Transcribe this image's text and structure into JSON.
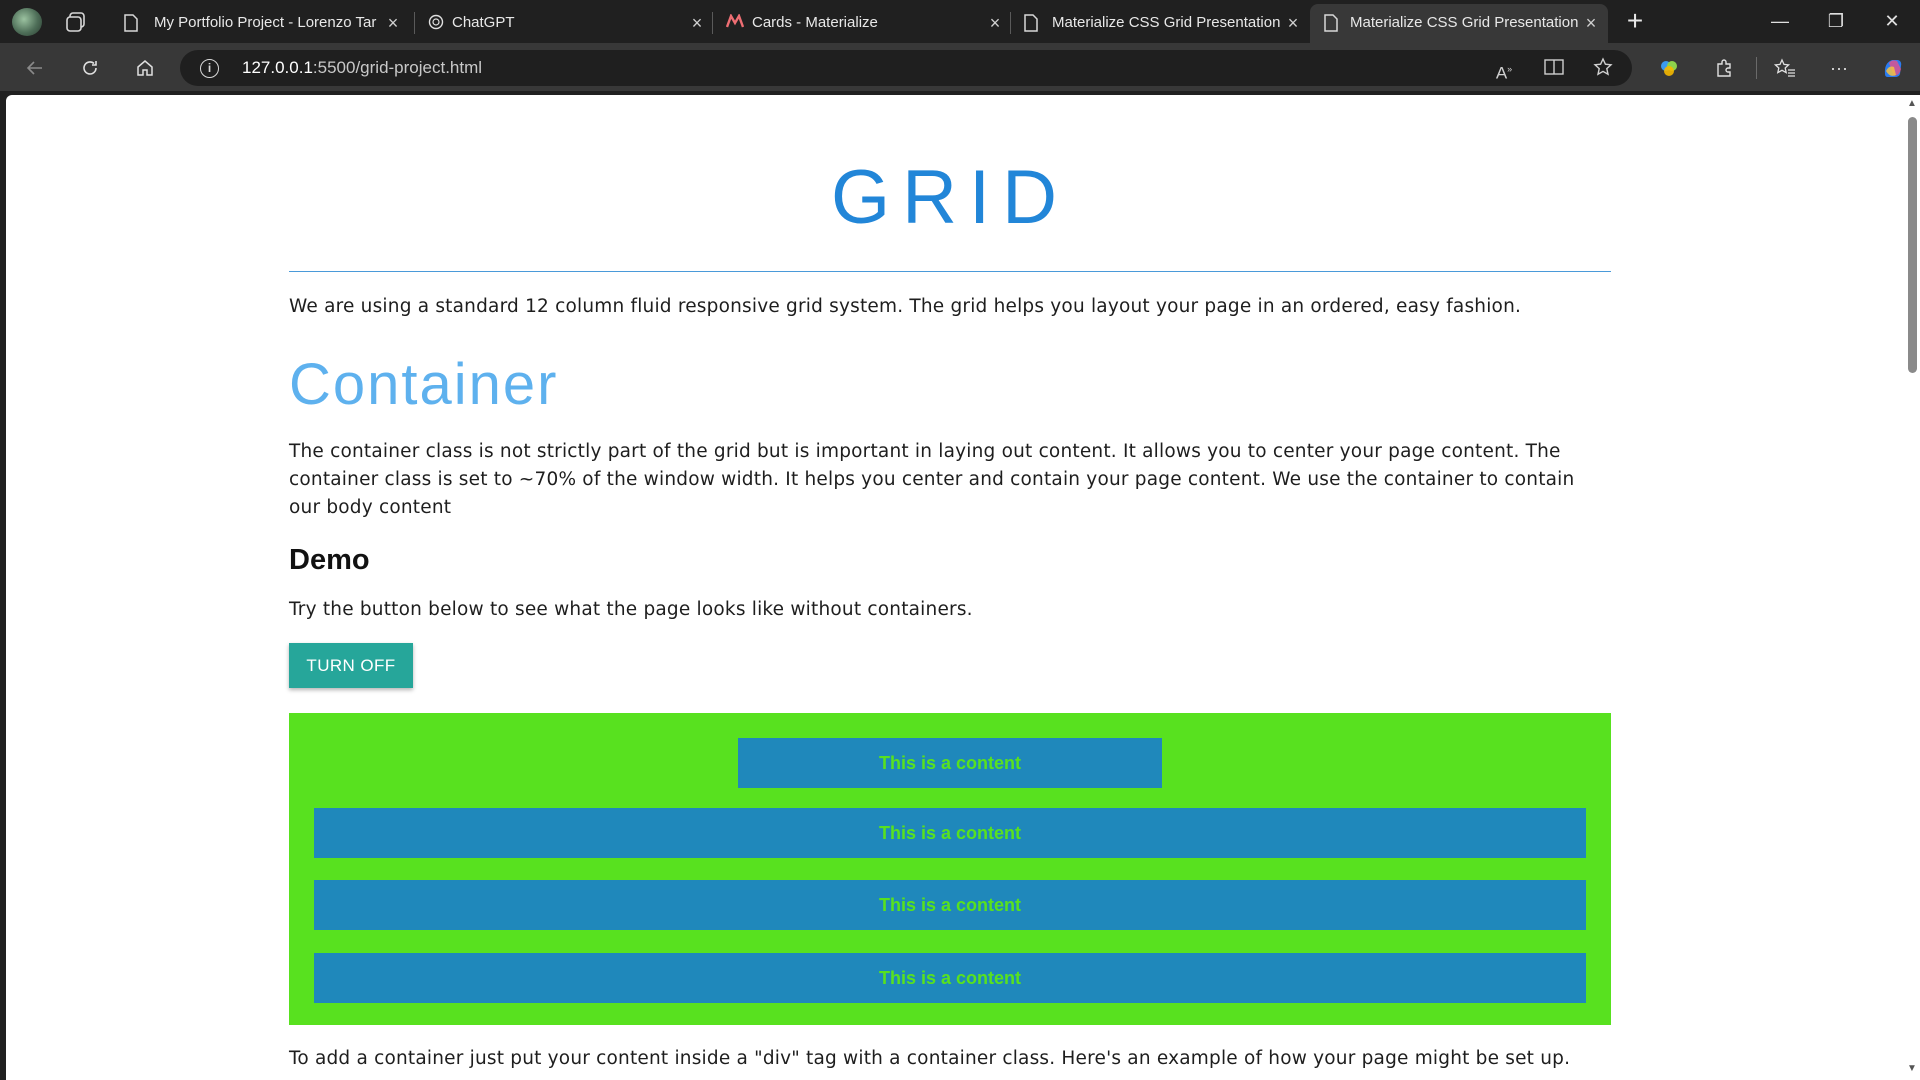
{
  "browser": {
    "tabs": [
      {
        "title": "My Portfolio Project - Lorenzo Tar",
        "icon": "page-icon"
      },
      {
        "title": "ChatGPT",
        "icon": "chatgpt-icon"
      },
      {
        "title": "Cards - Materialize",
        "icon": "materialize-icon"
      },
      {
        "title": "Materialize CSS Grid Presentation",
        "icon": "page-icon"
      },
      {
        "title": "Materialize CSS Grid Presentation",
        "icon": "page-icon",
        "active": true
      }
    ],
    "close_glyph": "×",
    "new_tab_glyph": "+",
    "url_host": "127.0.0.1",
    "url_rest": ":5500/grid-project.html",
    "window_controls": {
      "minimize": "—",
      "restore": "❐",
      "close": "✕"
    }
  },
  "page": {
    "title": "GRID",
    "intro": "We are using a standard 12 column fluid responsive grid system. The grid helps you layout your page in an ordered, easy fashion.",
    "container_heading": "Container",
    "container_text": "The container class is not strictly part of the grid but is important in laying out content. It allows you to center your page content. The container class is set to ~70% of the window width. It helps you center and contain your page content. We use the container to contain our body content",
    "demo_heading": "Demo",
    "demo_text": "Try the button below to see what the page looks like without containers.",
    "button_label": "TURN OFF",
    "content_blocks": [
      "This is a content",
      "This is a content",
      "This is a content",
      "This is a content"
    ],
    "footer_text": "To add a container just put your content inside a \"div\" tag with a container class. Here's an example of how your page might be set up."
  },
  "colors": {
    "title": "#2286d8",
    "section_heading": "#5eb1ee",
    "button": "#26a69a",
    "demo_background": "#58e11f",
    "content_block": "#1f88bb"
  }
}
